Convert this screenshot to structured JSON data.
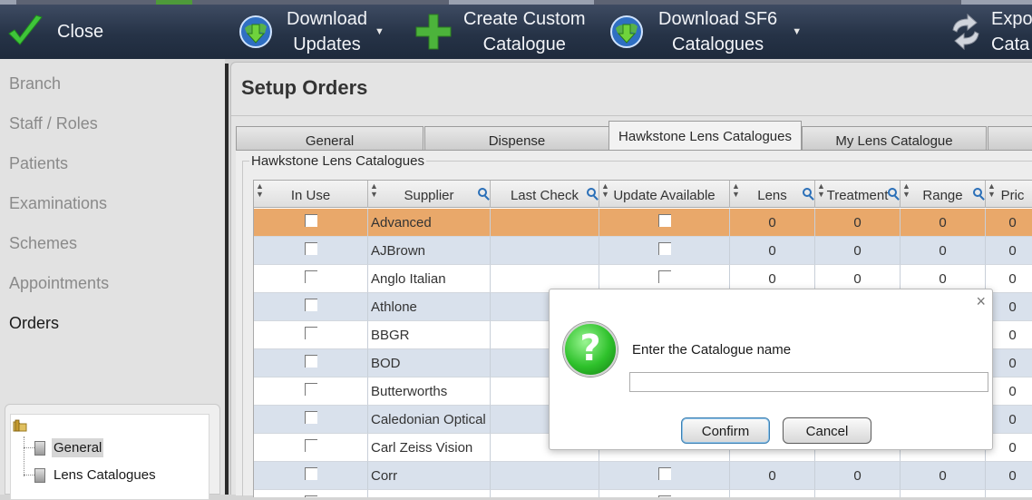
{
  "toolbar": {
    "close": "Close",
    "download_updates": {
      "line1": "Download",
      "line2": "Updates"
    },
    "create_custom": {
      "line1": "Create Custom",
      "line2": "Catalogue"
    },
    "download_sf6": {
      "line1": "Download SF6",
      "line2": "Catalogues"
    },
    "export": {
      "line1": "Expo",
      "line2": "Cata"
    }
  },
  "sidebar": {
    "items": [
      "Branch",
      "Staff / Roles",
      "Patients",
      "Examinations",
      "Schemes",
      "Appointments",
      "Orders"
    ],
    "active": "Orders",
    "tree": {
      "children": [
        "General",
        "Lens Catalogues"
      ],
      "selected": "General"
    }
  },
  "main": {
    "title": "Setup Orders",
    "tabs": [
      "General",
      "Dispense",
      "Hawkstone Lens Catalogues",
      "My Lens Catalogue",
      ""
    ],
    "active_tab": "Hawkstone Lens Catalogues",
    "group_label": "Hawkstone Lens Catalogues",
    "grid": {
      "columns": [
        "In Use",
        "Supplier",
        "Last Check",
        "Update Available",
        "Lens",
        "Treatment",
        "Range",
        "Pric"
      ],
      "rows": [
        {
          "supplier": "Advanced",
          "lens": "0",
          "treatment": "0",
          "range": "0",
          "price": "0",
          "selected": true,
          "update_box": true
        },
        {
          "supplier": "AJBrown",
          "lens": "0",
          "treatment": "0",
          "range": "0",
          "price": "0",
          "update_box": true
        },
        {
          "supplier": "Anglo Italian",
          "lens": "0",
          "treatment": "0",
          "range": "0",
          "price": "0",
          "update_box": true
        },
        {
          "supplier": "Athlone",
          "lens": "",
          "treatment": "",
          "range": "",
          "price": "0",
          "update_box": false
        },
        {
          "supplier": "BBGR",
          "lens": "",
          "treatment": "",
          "range": "",
          "price": "0",
          "update_box": false
        },
        {
          "supplier": "BOD",
          "lens": "",
          "treatment": "",
          "range": "",
          "price": "0",
          "update_box": false
        },
        {
          "supplier": "Butterworths",
          "lens": "",
          "treatment": "",
          "range": "",
          "price": "0",
          "update_box": false
        },
        {
          "supplier": "Caledonian Optical",
          "lens": "",
          "treatment": "",
          "range": "",
          "price": "0",
          "update_box": false
        },
        {
          "supplier": "Carl Zeiss Vision",
          "lens": "",
          "treatment": "",
          "range": "",
          "price": "0",
          "update_box": false
        },
        {
          "supplier": "Corr",
          "lens": "0",
          "treatment": "0",
          "range": "0",
          "price": "0",
          "update_box": true
        },
        {
          "supplier": "",
          "lens": "",
          "treatment": "",
          "range": "",
          "price": "",
          "update_box": true
        }
      ]
    }
  },
  "dialog": {
    "message": "Enter the Catalogue name",
    "input_value": "",
    "confirm": "Confirm",
    "cancel": "Cancel",
    "close_glyph": "×",
    "icon_glyph": "?"
  },
  "colors": {
    "toolbar": "#263347",
    "selected_row": "#e9a86a",
    "alt_row": "#d9e1ec",
    "accent_green": "#2ec12b"
  }
}
